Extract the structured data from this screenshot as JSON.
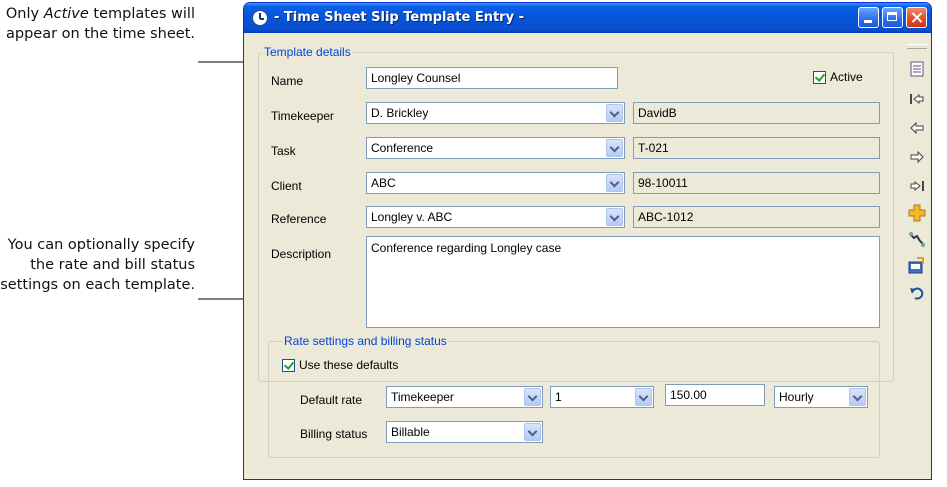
{
  "callouts": {
    "active_before": "Only ",
    "active_word": "Active",
    "active_after": " templates will appear on the time sheet.",
    "rate": "You can optionally specify the rate and bill status settings on each template."
  },
  "window": {
    "title": "- Time Sheet Slip Template Entry -",
    "buttons": {
      "minimize": "minimize-icon",
      "maximize": "maximize-icon",
      "close": "close-icon"
    }
  },
  "template_details": {
    "legend": "Template details",
    "name_label": "Name",
    "name_value": "Longley Counsel",
    "active_label": "Active",
    "active_checked": true,
    "timekeeper_label": "Timekeeper",
    "timekeeper_value": "D. Brickley",
    "timekeeper_code": "DavidB",
    "task_label": "Task",
    "task_value": "Conference",
    "task_code": "T-021",
    "client_label": "Client",
    "client_value": "ABC",
    "client_code": "98-10011",
    "reference_label": "Reference",
    "reference_value": "Longley v. ABC",
    "reference_code": "ABC-1012",
    "description_label": "Description",
    "description_value": "Conference regarding Longley case"
  },
  "rate_settings": {
    "legend": "Rate settings and billing status",
    "use_defaults_label": "Use these defaults",
    "use_defaults_checked": true,
    "default_rate_label": "Default rate",
    "rate_source": "Timekeeper",
    "rate_level": "1",
    "rate_amount": "150.00",
    "rate_unit": "Hourly",
    "billing_status_label": "Billing status",
    "billing_status_value": "Billable"
  },
  "toolbar": {
    "icons": [
      "list-icon",
      "first-record-icon",
      "previous-record-icon",
      "next-record-icon",
      "last-record-icon",
      "new-record-icon",
      "find-icon",
      "edit-icon",
      "undo-icon"
    ]
  },
  "colors": {
    "titlebar": "#0a5fe8",
    "dialog_bg": "#ece9d8",
    "legend_text": "#0046d5",
    "check_mark": "#21a121"
  }
}
